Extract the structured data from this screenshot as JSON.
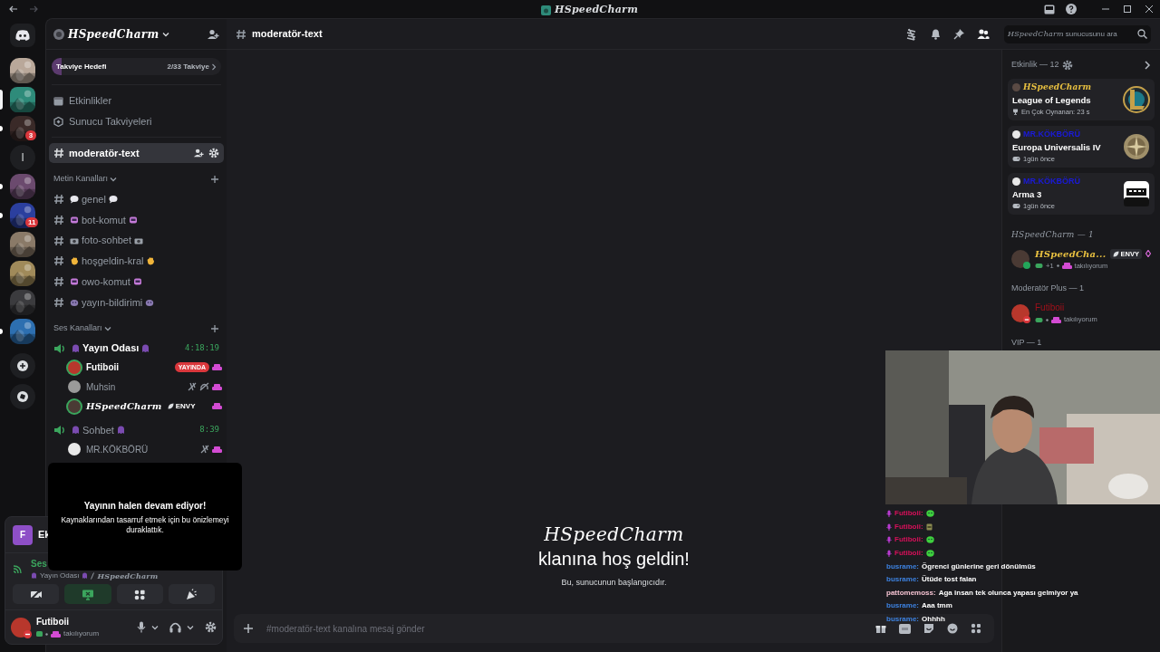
{
  "title_bar": {
    "title": "HSpeedCharm"
  },
  "servers": [
    {
      "kind": "avatar",
      "selected": false,
      "unread": false,
      "color": "#b9a89a"
    },
    {
      "kind": "avatar",
      "selected": true,
      "unread": false,
      "color": "#2e8b7a"
    },
    {
      "kind": "avatar",
      "selected": false,
      "unread": true,
      "color": "#3a2a28",
      "badge": "3"
    },
    {
      "kind": "letter",
      "selected": false,
      "unread": false,
      "label": "l"
    },
    {
      "kind": "avatar",
      "selected": false,
      "unread": true,
      "color": "#6b4a6e"
    },
    {
      "kind": "avatar",
      "selected": false,
      "unread": true,
      "color": "#2b3f9e",
      "badge": "11"
    },
    {
      "kind": "avatar",
      "selected": false,
      "unread": false,
      "color": "#8a7a68"
    },
    {
      "kind": "avatar",
      "selected": false,
      "unread": false,
      "color": "#a08a5a"
    },
    {
      "kind": "avatar",
      "selected": false,
      "unread": false,
      "color": "#3b3b3e"
    },
    {
      "kind": "avatar",
      "selected": false,
      "unread": true,
      "color": "#2d6fb0"
    }
  ],
  "sidebar": {
    "server_name": "HSpeedCharm",
    "boost": {
      "label": "Takviye Hedefi",
      "progress": "2/33 Takviye",
      "level": 0.06
    },
    "links": [
      "Etkinlikler",
      "Sunucu Takviyeleri"
    ],
    "active_channel": "moderatör-text",
    "text_category": {
      "name": "Metin Kanalları",
      "channels": [
        {
          "name": "genel",
          "kind": "bubble"
        },
        {
          "name": "bot-komut",
          "kind": "robot"
        },
        {
          "name": "foto-sohbet",
          "kind": "camera"
        },
        {
          "name": "hoşgeldin-kral",
          "kind": "hand"
        },
        {
          "name": "owo-komut",
          "kind": "robot"
        },
        {
          "name": "yayın-bildirimi",
          "kind": "alien"
        }
      ]
    },
    "voice_category": {
      "name": "Ses Kanalları",
      "channels": [
        {
          "name": "Yayın Odası",
          "timer": "4:18:19",
          "active": true,
          "users": [
            {
              "name": "Futiboii",
              "color": "#b8372c",
              "speaking": true,
              "live": "YAYINDA",
              "muted": false,
              "deafened": false,
              "script": false
            },
            {
              "name": "Muhsin",
              "color": "#9a9a9a",
              "speaking": false,
              "muted": true,
              "deafened": true,
              "script": false
            },
            {
              "name": "HSpeedCharm",
              "color": "#4a3a34",
              "speaking": true,
              "tag": "ENVY",
              "muted": false,
              "deafened": false,
              "script": true
            }
          ]
        },
        {
          "name": "Sohbet",
          "timer": "8:39",
          "active": false,
          "users": [
            {
              "name": "MR.KÖKBÖRÜ",
              "color": "#e8e8e8",
              "speaking": false,
              "muted": true,
              "deafened": false,
              "script": false
            }
          ]
        }
      ]
    },
    "activity_panel": {
      "letter": "F",
      "title": "Ek"
    },
    "voice_panel": {
      "title": "Ses",
      "channel": "Yayın Odası",
      "server": "HSpeedCharm"
    },
    "voice_buttons": [
      {
        "kind": "camera",
        "on": false
      },
      {
        "kind": "screen",
        "on": true
      },
      {
        "kind": "activities",
        "on": false
      },
      {
        "kind": "soundboard",
        "on": false
      }
    ],
    "user": {
      "name": "Futiboii",
      "status": "takılıyorum"
    }
  },
  "stream_notice": {
    "title": "Yayının halen devam ediyor!",
    "text": "Kaynaklarından tasarruf etmek için bu önizlemeyi duraklattık."
  },
  "channel_header": {
    "name": "moderatör-text",
    "search_server": "HSpeedCharm",
    "search_placeholder": "sunucusunu ara"
  },
  "welcome": {
    "server": "HSpeedCharm",
    "title": "klanına hoş geldin!",
    "subtitle": "Bu, sunucunun başlangıcıdır."
  },
  "composer": {
    "placeholder": "#moderatör-text kanalına mesaj gönder"
  },
  "members": {
    "activity_title": "Etkinlik — 12",
    "activities": [
      {
        "user": "HSpeedCharm",
        "color": "#e8c040",
        "script": true,
        "game": "League of Legends",
        "detail": "En Çok Oynanan: 23 s",
        "kind": "league"
      },
      {
        "user": "MR.KÖKBÖRÜ",
        "color": "#1a1ad8",
        "script": false,
        "game": "Europa Universalis IV",
        "detail": "1gün önce",
        "kind": "compass"
      },
      {
        "user": "MR.KÖKBÖRÜ",
        "color": "#1a1ad8",
        "script": false,
        "game": "Arma 3",
        "detail": "1gün önce",
        "kind": "arma"
      }
    ],
    "sections": [
      {
        "heading": "HSpeedCharm — 1",
        "script": true,
        "members": [
          {
            "name": "HSpeedCha...",
            "color": "#e8c040",
            "script": true,
            "tag": "ENVY",
            "extra": "+1",
            "status": "takılıyorum",
            "dnd": false
          }
        ]
      },
      {
        "heading": "Moderatör Plus — 1",
        "script": false,
        "members": [
          {
            "name": "Futiboii",
            "color": "#a0101a",
            "script": false,
            "status": "takılıyorum",
            "dnd": true
          }
        ]
      },
      {
        "heading": "VIP — 1",
        "script": false
      }
    ]
  },
  "stream_chat": [
    {
      "kind": "frog",
      "user": "Futiboii:",
      "color": "#d8105a"
    },
    {
      "kind": "sticker",
      "user": "Futiboii:",
      "color": "#d8105a"
    },
    {
      "kind": "frog",
      "user": "Futiboii:",
      "color": "#d8105a"
    },
    {
      "kind": "frog",
      "user": "Futiboii:",
      "color": "#d8105a"
    },
    {
      "kind": "message",
      "user": "busrame:",
      "color": "#3d82e0",
      "text": "Ögrenci günlerine geri dönülmüs"
    },
    {
      "kind": "message",
      "user": "busrame:",
      "color": "#3d82e0",
      "text": "Ütüde tost falan"
    },
    {
      "kind": "message",
      "user": "pattomemoss:",
      "color": "#f3c1d0",
      "text": "Aga insan tek olunca yapası gelmiyor ya"
    },
    {
      "kind": "message",
      "user": "busrame:",
      "color": "#3d82e0",
      "text": "Aaa tmm"
    },
    {
      "kind": "message",
      "user": "busrame:",
      "color": "#3d82e0",
      "text": "Ohhhh"
    }
  ]
}
